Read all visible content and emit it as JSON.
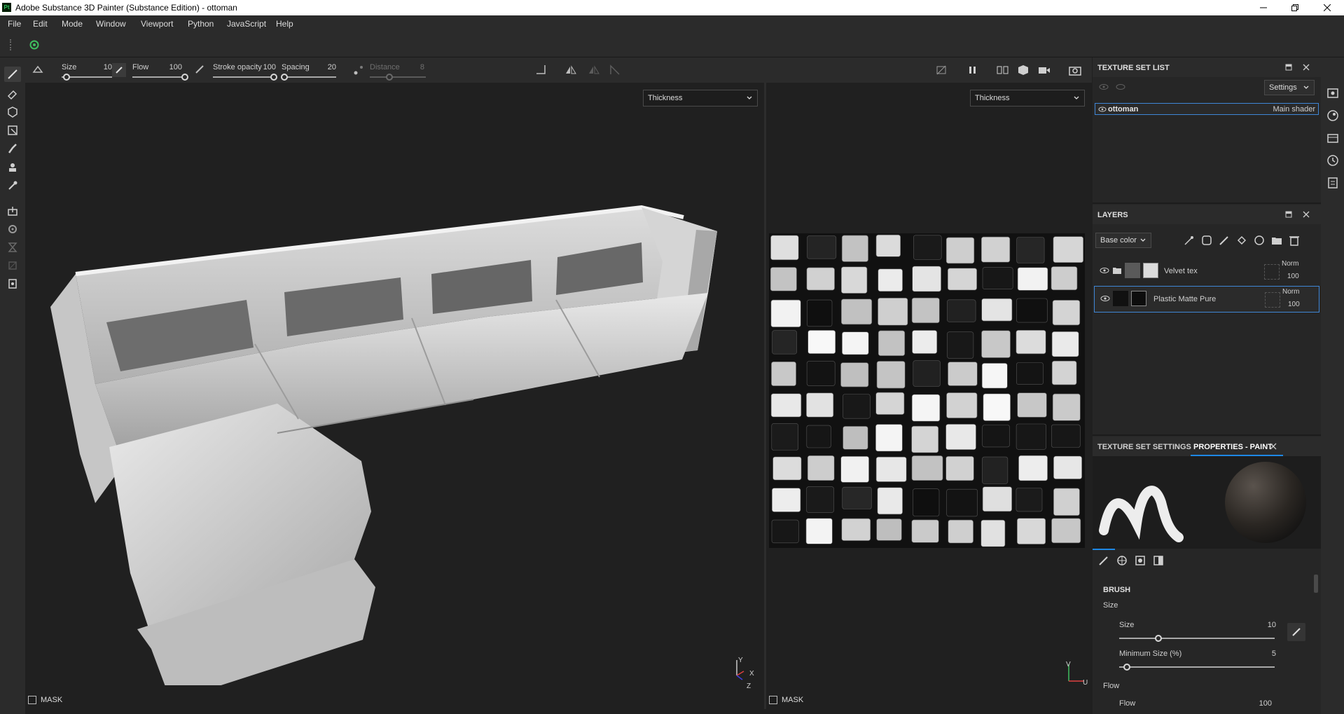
{
  "app": {
    "title": "Adobe Substance 3D Painter (Substance Edition) - ottoman",
    "logo_text": "Pt"
  },
  "menu": [
    "File",
    "Edit",
    "Mode",
    "Window",
    "Viewport",
    "Python",
    "JavaScript",
    "Help"
  ],
  "toolbar": {
    "size_label": "Size",
    "size_value": "10",
    "flow_label": "Flow",
    "flow_value": "100",
    "stroke_opacity_label": "Stroke opacity",
    "stroke_opacity_value": "100",
    "spacing_label": "Spacing",
    "spacing_value": "20",
    "distance_label": "Distance",
    "distance_value": "8",
    "size_fraction": 0.1,
    "flow_fraction": 1.0,
    "stroke_opacity_fraction": 1.0,
    "spacing_fraction": 0.05,
    "distance_fraction": 0.35
  },
  "viewport3d": {
    "channel": "Thickness",
    "mask_label": "MASK"
  },
  "viewport2d": {
    "channel": "Thickness",
    "mask_label": "MASK"
  },
  "axes3d": {
    "y": "Y",
    "x": "X",
    "z": "Z"
  },
  "axes2d": {
    "v": "V",
    "u": "U"
  },
  "texture_set_list": {
    "title": "TEXTURE SET LIST",
    "settings_label": "Settings",
    "items": [
      {
        "name": "ottoman",
        "shader": "Main shader"
      }
    ]
  },
  "layers": {
    "title": "LAYERS",
    "channel": "Base color",
    "items": [
      {
        "name": "Velvet tex",
        "blend": "Norm",
        "opacity": "100"
      },
      {
        "name": "Plastic Matte Pure",
        "blend": "Norm",
        "opacity": "100"
      }
    ]
  },
  "properties": {
    "tab_texture_set_settings": "TEXTURE SET SETTINGS",
    "tab_properties_paint": "PROPERTIES - PAINT",
    "section_brush": "BRUSH",
    "group_size": "Size",
    "size_label": "Size",
    "size_value": "10",
    "size_fraction": 0.25,
    "min_size_label": "Minimum Size (%)",
    "min_size_value": "5",
    "min_size_fraction": 0.05,
    "group_flow": "Flow",
    "flow_label": "Flow",
    "flow_value": "100"
  },
  "colors": {
    "background": "#202020",
    "panel": "#262626",
    "header": "#2b2b2b",
    "selection": "#1f7ad6",
    "accent": "#1e88e5"
  }
}
